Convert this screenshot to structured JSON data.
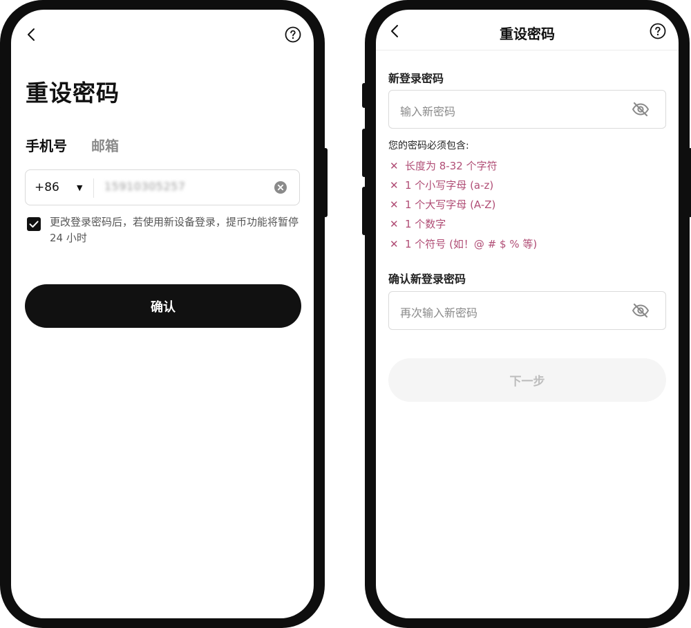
{
  "left_screen": {
    "title": "重设密码",
    "tabs": [
      {
        "label": "手机号",
        "active": true
      },
      {
        "label": "邮箱",
        "active": false
      }
    ],
    "phone_input": {
      "country_code": "+86",
      "value": "15910305257"
    },
    "notice": {
      "checked": true,
      "text": "更改登录密码后，若使用新设备登录，提币功能将暂停 24 小时"
    },
    "confirm_label": "确认"
  },
  "right_screen": {
    "header_title": "重设密码",
    "new_password": {
      "label": "新登录密码",
      "placeholder": "输入新密码"
    },
    "requirements": {
      "title": "您的密码必须包含:",
      "items": [
        "长度为 8-32 个字符",
        "1 个小写字母 (a-z)",
        "1 个大写字母 (A-Z)",
        "1 个数字",
        "1 个符号 (如！@ # $ % 等)"
      ]
    },
    "confirm_password": {
      "label": "确认新登录密码",
      "placeholder": "再次输入新密码"
    },
    "next_label": "下一步"
  },
  "colors": {
    "requirement_text": "#b04d75",
    "primary_button": "#111111",
    "disabled_button": "#f5f5f5"
  },
  "icons": [
    "back-chevron-icon",
    "help-icon",
    "clear-icon",
    "eye-off-icon",
    "check-icon",
    "caret-down-icon",
    "close-x-icon"
  ]
}
